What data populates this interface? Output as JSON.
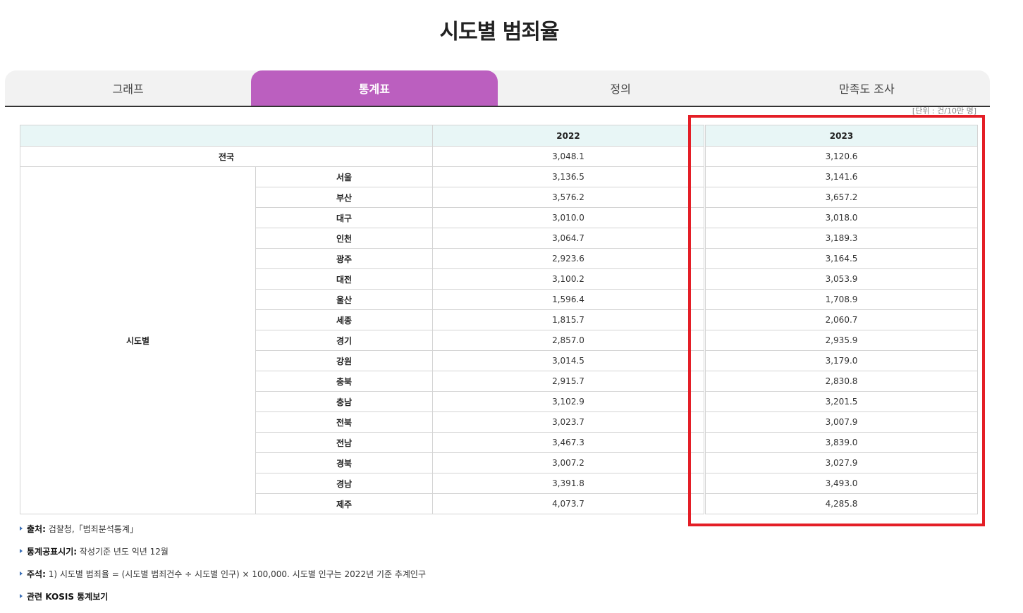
{
  "title": "시도별 범죄율",
  "tabs": [
    {
      "label": "그래프",
      "active": false
    },
    {
      "label": "통계표",
      "active": true
    },
    {
      "label": "정의",
      "active": false
    },
    {
      "label": "만족도 조사",
      "active": false
    }
  ],
  "unit": "[단위 : 건/10만 명]",
  "table": {
    "years": [
      "2022",
      "2023"
    ],
    "national": {
      "label": "전국",
      "values": [
        "3,048.1",
        "3,120.6"
      ]
    },
    "group_label": "시도별",
    "regions": [
      {
        "name": "서울",
        "values": [
          "3,136.5",
          "3,141.6"
        ]
      },
      {
        "name": "부산",
        "values": [
          "3,576.2",
          "3,657.2"
        ]
      },
      {
        "name": "대구",
        "values": [
          "3,010.0",
          "3,018.0"
        ]
      },
      {
        "name": "인천",
        "values": [
          "3,064.7",
          "3,189.3"
        ]
      },
      {
        "name": "광주",
        "values": [
          "2,923.6",
          "3,164.5"
        ]
      },
      {
        "name": "대전",
        "values": [
          "3,100.2",
          "3,053.9"
        ]
      },
      {
        "name": "울산",
        "values": [
          "1,596.4",
          "1,708.9"
        ]
      },
      {
        "name": "세종",
        "values": [
          "1,815.7",
          "2,060.7"
        ]
      },
      {
        "name": "경기",
        "values": [
          "2,857.0",
          "2,935.9"
        ]
      },
      {
        "name": "강원",
        "values": [
          "3,014.5",
          "3,179.0"
        ]
      },
      {
        "name": "충북",
        "values": [
          "2,915.7",
          "2,830.8"
        ]
      },
      {
        "name": "충남",
        "values": [
          "3,102.9",
          "3,201.5"
        ]
      },
      {
        "name": "전북",
        "values": [
          "3,023.7",
          "3,007.9"
        ]
      },
      {
        "name": "전남",
        "values": [
          "3,467.3",
          "3,839.0"
        ]
      },
      {
        "name": "경북",
        "values": [
          "3,007.2",
          "3,027.9"
        ]
      },
      {
        "name": "경남",
        "values": [
          "3,391.8",
          "3,493.0"
        ]
      },
      {
        "name": "제주",
        "values": [
          "4,073.7",
          "4,285.8"
        ]
      }
    ]
  },
  "notes": [
    {
      "label": "출처:",
      "text": " 검찰청,「범죄분석통계」"
    },
    {
      "label": "통계공표시기:",
      "text": " 작성기준 년도 익년 12월"
    },
    {
      "label": "주석:",
      "text": " 1) 시도별 범죄율 = (시도별 범죄건수 ÷ 시도별 인구) × 100,000. 시도별 인구는 2022년 기준 추계인구"
    },
    {
      "label": "관련 KOSIS 통계보기",
      "text": ""
    }
  ],
  "colors": {
    "accent": "#bb5fbf",
    "header_bg": "#e8f6f6",
    "highlight": "#e41e26"
  }
}
